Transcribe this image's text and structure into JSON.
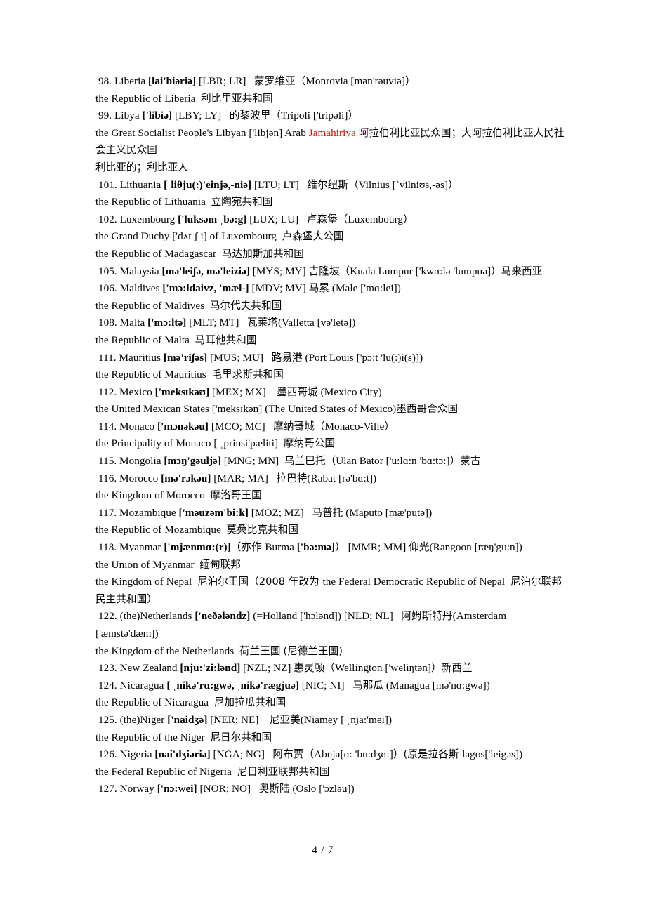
{
  "document": {
    "page_number": "4 / 7",
    "accent_color": "#ff0000",
    "lines": [
      {
        "id": "liberia-entry",
        "kind": "entry",
        "text": "98. Liberia [lai'biəriə] [LBR; LR]　蒙罗维亚（Monrovia [mən'rəuviə]）"
      },
      {
        "id": "liberia-official",
        "kind": "cont",
        "text": "the Republic of Liberia  利比里亚共和国"
      },
      {
        "id": "libya-entry",
        "kind": "entry",
        "text": "99. Libya ['libiə] [LBY; LY]　 的黎波里（Tripoli ['tripəli]）"
      },
      {
        "id": "libya-official",
        "kind": "cont",
        "text": "the Great Socialist People's Libyan ['libjən] Arab Jamahiriya 阿拉伯利比亚民众国；大阿拉伯利比亚人民社会主义民众国"
      },
      {
        "id": "libya-adjective",
        "kind": "cont",
        "text": "利比亚的；利比亚人"
      },
      {
        "id": "lithuania-entry",
        "kind": "entry",
        "text": "101. Lithuania [ˌliθju(:)'einjə,-niə] [LTU; LT]　维尔纽斯（Vilnius [ˋvilniʊs,-əs]）"
      },
      {
        "id": "lithuania-official",
        "kind": "cont",
        "text": "the Republic of Lithuania  立陶宛共和国"
      },
      {
        "id": "luxembourg-entry",
        "kind": "entry",
        "text": "102. Luxembourg ['luksəm ˌbə:g] [LUX; LU]　 卢森堡（Luxembourg）"
      },
      {
        "id": "luxembourg-official",
        "kind": "cont",
        "text": "the Grand Duchy ['dʌt ʃ i] of Luxembourg  卢森堡大公国"
      },
      {
        "id": "madagascar-official",
        "kind": "cont",
        "text": "the Republic of Madagascar  马达加斯加共和国"
      },
      {
        "id": "malaysia-entry",
        "kind": "entry",
        "text": "105. Malaysia [mə'leiʃə, mə'leiziə] [MYS; MY] 吉隆坡（Kuala Lumpur ['kwɑ:lə 'lumpuə]）马来西亚"
      },
      {
        "id": "maldives-entry",
        "kind": "entry",
        "text": "106. Maldives ['mɔ:ldaivz, 'mæl-] [MDV; MV] 马累 (Male ['mɑ:lei])"
      },
      {
        "id": "maldives-official",
        "kind": "cont",
        "text": "the Republic of Maldives  马尔代夫共和国"
      },
      {
        "id": "malta-entry",
        "kind": "entry",
        "text": "108. Malta ['mɔ:ltə] [MLT; MT]　 瓦莱塔(Valletta [və'letə])"
      },
      {
        "id": "malta-official",
        "kind": "cont",
        "text": "the Republic of Malta  马耳他共和国"
      },
      {
        "id": "mauritius-entry",
        "kind": "entry",
        "text": "111. Mauritius [mə'riʃəs] [MUS; MU]　 路易港 (Port Louis ['pɔ:t 'lu(:)i(s)])"
      },
      {
        "id": "mauritius-official",
        "kind": "cont",
        "text": "the Republic of Mauritius  毛里求斯共和国"
      },
      {
        "id": "mexico-entry",
        "kind": "entry",
        "text": "112. Mexico ['meksɪkəʊ] [MEX; MX]　　墨西哥城 (Mexico City)"
      },
      {
        "id": "mexico-official",
        "kind": "cont",
        "text": "the United Mexican States ['meksɪkən] (The United States of Mexico)墨西哥合众国"
      },
      {
        "id": "monaco-entry",
        "kind": "entry",
        "text": "114. Monaco ['mɔnəkəu] [MCO; MC]　 摩纳哥城（Monaco-Ville）"
      },
      {
        "id": "monaco-official",
        "kind": "cont",
        "text": "the Principality of Monaco [ ˌprinsi'pæliti]  摩纳哥公国"
      },
      {
        "id": "mongolia-entry",
        "kind": "entry",
        "text": "115. Mongolia [mɔŋ'gəuljə] [MNG; MN]　乌兰巴托（Ulan Bator ['u:lɑ:n 'bɑ:tɔ:]）蒙古"
      },
      {
        "id": "morocco-entry",
        "kind": "entry",
        "text": "116. Morocco [mə'rɔkəu] [MAR; MA]　 拉巴特(Rabat [rə'bɑ:t])"
      },
      {
        "id": "morocco-official",
        "kind": "cont",
        "text": "the Kingdom of Morocco  摩洛哥王国"
      },
      {
        "id": "mozambique-entry",
        "kind": "entry",
        "text": "117. Mozambique ['məuzəm'bi:k] [MOZ; MZ]　 马普托 (Maputo [mæ'putə])"
      },
      {
        "id": "mozambique-official",
        "kind": "cont",
        "text": "the Republic of Mozambique  莫桑比克共和国"
      },
      {
        "id": "myanmar-entry",
        "kind": "entry",
        "text": "118. Myanmar ['mjænmɑ:(r)]（亦作 Burma ['bə:mə]）[MMR; MM] 仰光(Rangoon [ræŋ'gu:n])"
      },
      {
        "id": "myanmar-official",
        "kind": "cont",
        "text": "the Union of Myanmar  缅甸联邦"
      },
      {
        "id": "nepal-official",
        "kind": "cont",
        "text": "the Kingdom of Nepal  尼泊尔王国（2008 年改为 the Federal Democratic Republic of Nepal  尼泊尔联邦民主共和国）"
      },
      {
        "id": "netherlands-entry",
        "kind": "entry",
        "text": "122. (the)Netherlands ['neðələndz] (=Holland ['hɔlənd]) [NLD; NL]　 阿姆斯特丹(Amsterdam ['æmstə'dæm])"
      },
      {
        "id": "netherlands-official",
        "kind": "cont",
        "text": "the Kingdom of the Netherlands  荷兰王国 (尼德兰王国)"
      },
      {
        "id": "new-zealand-entry",
        "kind": "entry",
        "text": "123. New Zealand [nju:'zi:lənd] [NZL; NZ] 惠灵顿（Wellington ['weliŋtən]）新西兰"
      },
      {
        "id": "nicaragua-entry",
        "kind": "entry",
        "text": "124. Nicaragua [ ˌnikə'rɑ:gwə, ˌnikə'rægjuə] [NIC; NI]　 马那瓜 (Managua [mə'nɑ:gwə])"
      },
      {
        "id": "nicaragua-official",
        "kind": "cont",
        "text": "the Republic of Nicaragua  尼加拉瓜共和国"
      },
      {
        "id": "niger-entry",
        "kind": "entry",
        "text": "125. (the)Niger ['naidʒə] [NER; NE]　　尼亚美(Niamey [ ˌnja:'mei])"
      },
      {
        "id": "niger-official",
        "kind": "cont",
        "text": "the Republic of the Niger  尼日尔共和国"
      },
      {
        "id": "nigeria-entry",
        "kind": "entry",
        "text": "126. Nigeria [nai'dʒiəriə] [NGA; NG]　 阿布贾（Abuja[ɑ: 'bu:dʒɑ:]）(原是拉各斯 lagos['leigɔs])"
      },
      {
        "id": "nigeria-official",
        "kind": "cont",
        "text": "the Federal Republic of Nigeria  尼日利亚联邦共和国"
      },
      {
        "id": "norway-entry",
        "kind": "entry",
        "text": "127. Norway ['nɔ:wei] [NOR; NO]　 奥斯陆 (Oslo ['ɔzləu])"
      }
    ],
    "bold_ipa_segments": [
      "[lai'biəriə]",
      "['libiə]",
      "[ˌliθju(:)'einjə,-niə]",
      "['luksəm ˌbə:g]",
      "[mə'leiʃə, mə'leiziə]",
      "['mɔ:ldaivz, 'mæl-]",
      "['mɔ:ltə]",
      "[mə'riʃəs]",
      "['meksɪkəʊ]",
      "['mɔnəkəu]",
      "[mɔŋ'gəuljə]",
      "[mə'rɔkəu]",
      "['məuzəm'bi:k]",
      "['mjænmɑ:(r)]",
      "['bə:mə]",
      "['neðələndz]",
      "[nju:'zi:lənd]",
      "[ˌnikə'rɑ:gwə, ˌnikə'rægjuə]",
      "['naidʒə]",
      "[nai'dʒiəriə]",
      "['nɔ:wei]"
    ],
    "red_text": "Jamahiriya"
  }
}
